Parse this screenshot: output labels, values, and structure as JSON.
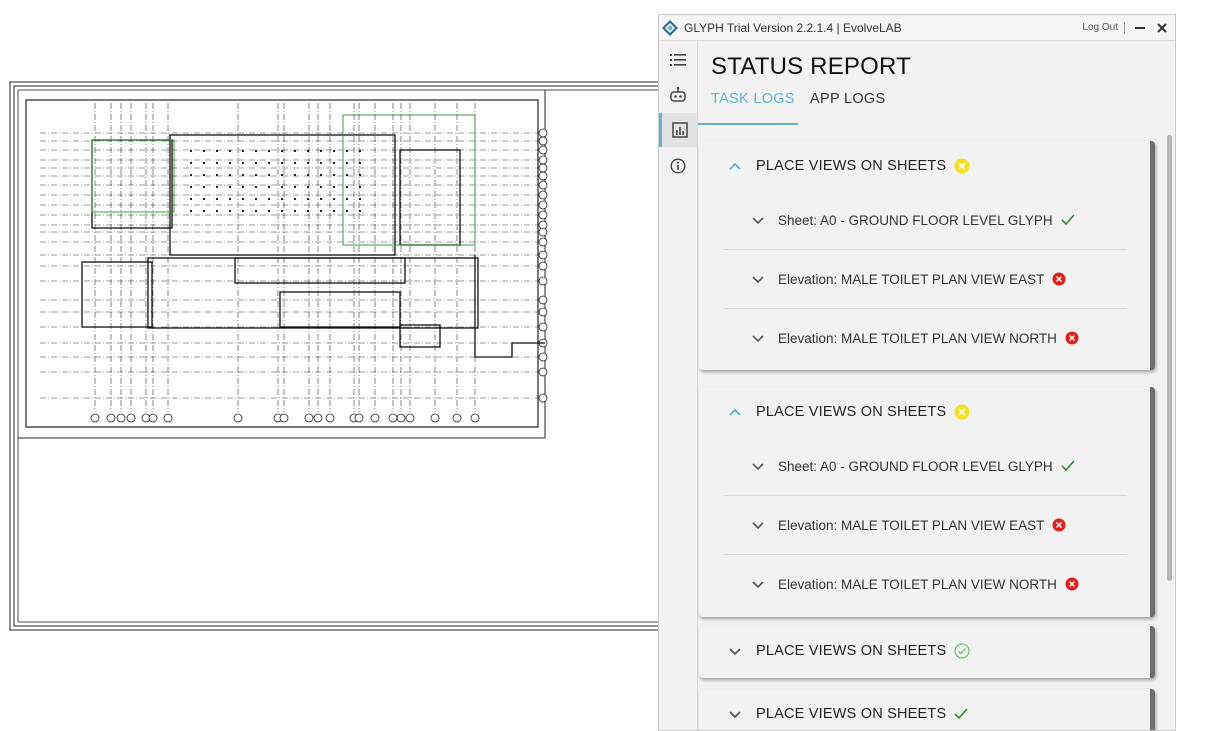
{
  "window": {
    "title": "GLYPH Trial Version  2.2.1.4 | EvolveLAB",
    "logout_label": "Log Out",
    "icons": [
      "glyph-logo-icon",
      "minimize-icon",
      "close-icon"
    ]
  },
  "sidebar": {
    "items": [
      {
        "icon": "list-icon",
        "active": false
      },
      {
        "icon": "robot-icon",
        "active": false
      },
      {
        "icon": "chart-icon",
        "active": true
      },
      {
        "icon": "info-icon",
        "active": false
      }
    ]
  },
  "main": {
    "title": "STATUS REPORT",
    "tabs": [
      {
        "label": "TASK LOGS",
        "active": true
      },
      {
        "label": "APP LOGS",
        "active": false
      }
    ]
  },
  "tasks": [
    {
      "title": "PLACE VIEWS ON SHEETS",
      "status": "warning",
      "expanded": true,
      "items": [
        {
          "label": "Sheet: A0 - GROUND FLOOR LEVEL GLYPH",
          "status": "success"
        },
        {
          "label": "Elevation: MALE TOILET PLAN VIEW EAST",
          "status": "error"
        },
        {
          "label": "Elevation: MALE TOILET PLAN VIEW NORTH",
          "status": "error"
        }
      ]
    },
    {
      "title": "PLACE VIEWS ON SHEETS",
      "status": "warning",
      "expanded": true,
      "items": [
        {
          "label": "Sheet: A0 - GROUND FLOOR LEVEL GLYPH",
          "status": "success"
        },
        {
          "label": "Elevation: MALE TOILET PLAN VIEW EAST",
          "status": "error"
        },
        {
          "label": "Elevation: MALE TOILET PLAN VIEW NORTH",
          "status": "error"
        }
      ]
    },
    {
      "title": "PLACE VIEWS ON SHEETS",
      "status": "success-circle",
      "expanded": false,
      "items": []
    },
    {
      "title": "PLACE VIEWS ON SHEETS",
      "status": "success",
      "expanded": false,
      "items": []
    }
  ],
  "colors": {
    "accent": "#62b1d0",
    "warning": "#f5e11b",
    "error": "#e0201c",
    "success": "#2e8b2e",
    "success_light": "#6cc26c"
  }
}
